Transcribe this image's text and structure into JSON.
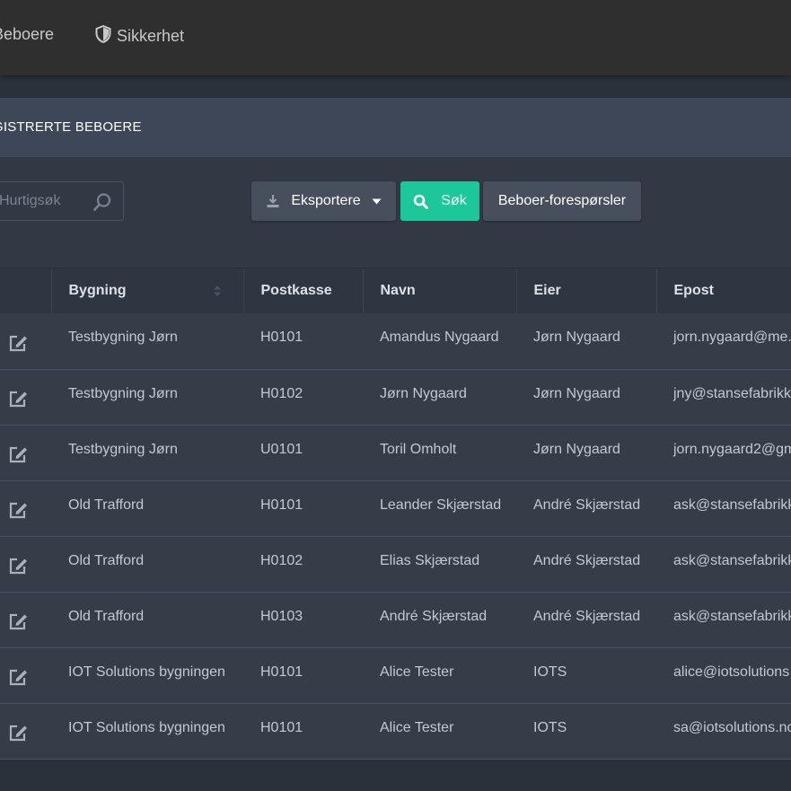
{
  "nav": {
    "residents_label": "Beboere",
    "security_label": "Sikkerhet"
  },
  "panel": {
    "title": "GISTRERTE BEBOERE"
  },
  "toolbar": {
    "search_placeholder": "Hurtigsøk",
    "export_label": "Eksportere",
    "search_label": "Søk",
    "requests_label": "Beboer-forespørsler"
  },
  "table": {
    "headers": {
      "building": "Bygning",
      "mailbox": "Postkasse",
      "name": "Navn",
      "owner": "Eier",
      "email": "Epost"
    },
    "rows": [
      {
        "building": "Testbygning Jørn",
        "mailbox": "H0101",
        "name": "Amandus Nygaard",
        "owner": "Jørn Nygaard",
        "email": "jorn.nygaard@me."
      },
      {
        "building": "Testbygning Jørn",
        "mailbox": "H0102",
        "name": "Jørn Nygaard",
        "owner": "Jørn Nygaard",
        "email": "jny@stansefabrikk"
      },
      {
        "building": "Testbygning Jørn",
        "mailbox": "U0101",
        "name": "Toril Omholt",
        "owner": "Jørn Nygaard",
        "email": "jorn.nygaard2@gm"
      },
      {
        "building": "Old Trafford",
        "mailbox": "H0101",
        "name": "Leander Skjærstad",
        "owner": "André Skjærstad",
        "email": "ask@stansefabrikk"
      },
      {
        "building": "Old Trafford",
        "mailbox": "H0102",
        "name": "Elias Skjærstad",
        "owner": "André Skjærstad",
        "email": "ask@stansefabrikk"
      },
      {
        "building": "Old Trafford",
        "mailbox": "H0103",
        "name": "André Skjærstad",
        "owner": "André Skjærstad",
        "email": "ask@stansefabrikk"
      },
      {
        "building": "IOT Solutions bygningen",
        "mailbox": "H0101",
        "name": "Alice Tester",
        "owner": "IOTS",
        "email": "alice@iotsolutions"
      },
      {
        "building": "IOT Solutions bygningen",
        "mailbox": "H0101",
        "name": "Alice Tester",
        "owner": "IOTS",
        "email": "sa@iotsolutions.no"
      }
    ]
  },
  "icons": {
    "nav_security": "shield-icon",
    "search": "search-icon",
    "export": "download-icon",
    "export_caret": "caret-down-icon",
    "search_button": "search-icon",
    "sort": "sort-icon",
    "row_edit": "edit-icon"
  },
  "colors": {
    "accent_green": "#1cc89a",
    "topbar": "#2f2f2f",
    "panel_header": "#3d4757",
    "row_bg": "#363d48"
  }
}
